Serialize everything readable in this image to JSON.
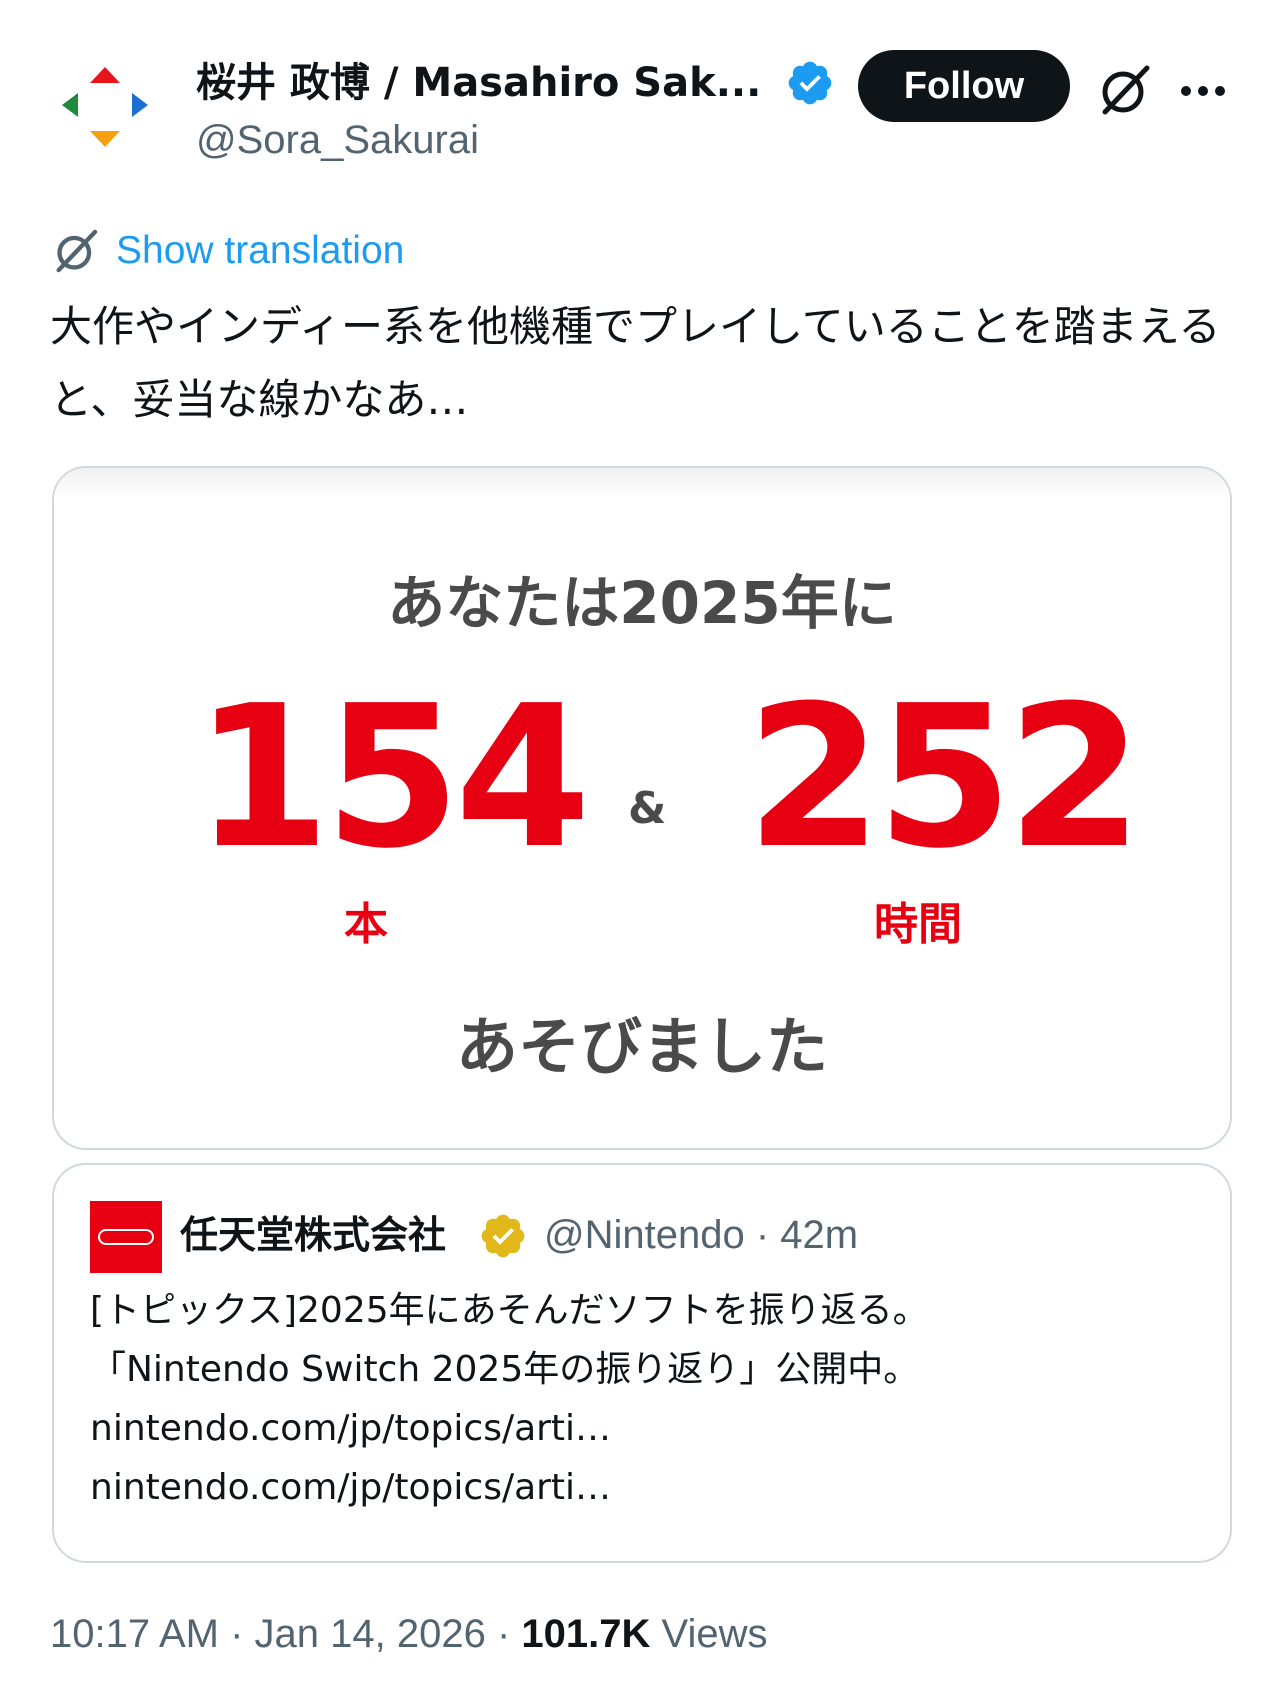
{
  "author": {
    "name": "桜井 政博 / Masahiro Sak...",
    "handle": "@Sora_Sakurai",
    "verified_color": "#1d9bf0"
  },
  "header": {
    "follow_label": "Follow",
    "grok_icon": "grok-icon",
    "more_icon": "more-icon"
  },
  "tweet": {
    "translate_label": "Show translation",
    "text": "大作やインディー系を他機種でプレイしていることを踏まえると、妥当な線かなあ…"
  },
  "media": {
    "heading": "あなたは2025年に",
    "count_value": "154",
    "count_unit": "本",
    "amp": "&",
    "hours_value": "252",
    "hours_unit": "時間",
    "footer": "あそびました",
    "accent_color": "#e60012"
  },
  "quote": {
    "name": "任天堂株式会社",
    "handle_time": "@Nintendo · 42m",
    "badge_color": "#e2b719",
    "lines": [
      "[トピックス]2025年にあそんだソフトを振り返る。",
      "「Nintendo Switch 2025年の振り返り」公開中。",
      "nintendo.com/jp/topics/arti…",
      "nintendo.com/jp/topics/arti…"
    ]
  },
  "footer": {
    "timestamp": "10:17 AM · Jan 14, 2026 · ",
    "views_count": "101.7K",
    "views_label": " Views"
  }
}
